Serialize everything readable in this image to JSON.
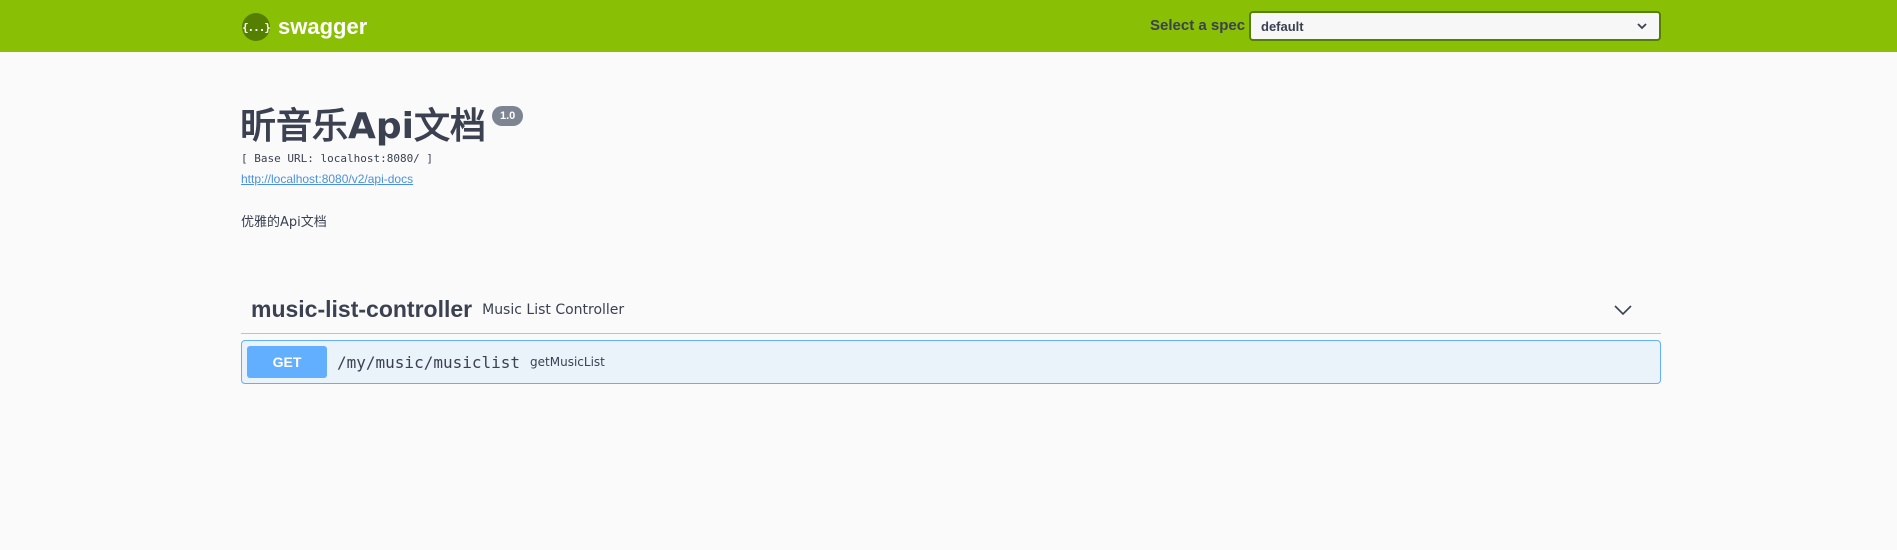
{
  "topbar": {
    "logo_glyph": "{...}",
    "brand": "swagger",
    "spec_label": "Select a spec",
    "spec_value": "default"
  },
  "info": {
    "title": "昕音乐Api文档",
    "version": "1.0",
    "base_url": "[ Base URL: localhost:8080/ ]",
    "api_docs_link": "http://localhost:8080/v2/api-docs",
    "description": "优雅的Api文档"
  },
  "tags": [
    {
      "name": "music-list-controller",
      "description": "Music List Controller",
      "operations": [
        {
          "method": "GET",
          "path": "/my/music/musiclist",
          "summary": "getMusicList"
        }
      ]
    }
  ],
  "colors": {
    "topbar": "#89bf04",
    "get": "#61affe",
    "text": "#3b4151"
  }
}
